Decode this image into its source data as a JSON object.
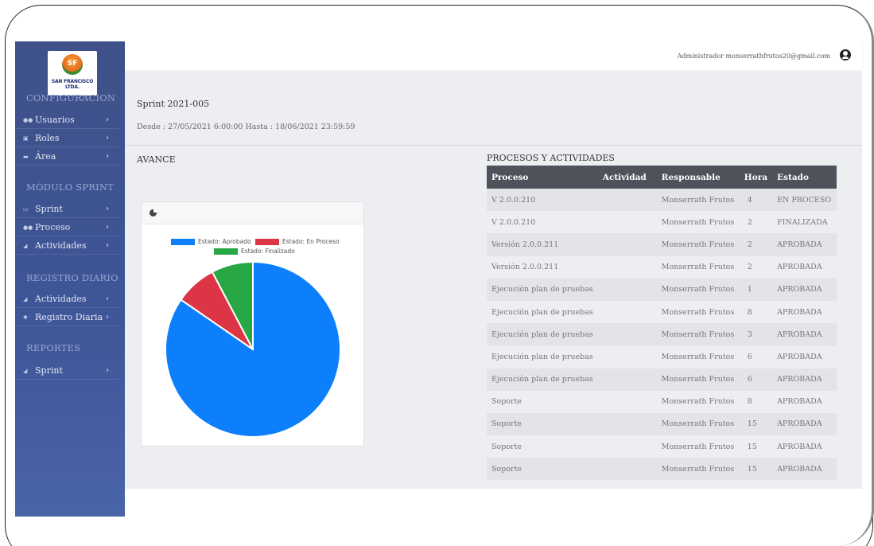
{
  "header": {
    "user_role": "Administrador",
    "user_email": "monserrathfrutos20@gmail.com"
  },
  "logo": {
    "initials": "SF",
    "company": "SAN FRANCISCO LTDA."
  },
  "sidebar": {
    "sections": [
      {
        "title": "CONFIGURACION"
      },
      {
        "title": "MÓDULO SPRINT"
      },
      {
        "title": "REGISTRO DIARIO"
      },
      {
        "title": "REPORTES"
      }
    ],
    "items": [
      {
        "label": "Usuarios",
        "icon": "users-icon"
      },
      {
        "label": "Roles",
        "icon": "roles-icon"
      },
      {
        "label": "Área",
        "icon": "folder-icon"
      },
      {
        "label": "Sprint",
        "icon": "sprint-icon"
      },
      {
        "label": "Proceso",
        "icon": "process-icon"
      },
      {
        "label": "Actividades",
        "icon": "activities-icon"
      },
      {
        "label": "Actividades",
        "icon": "activities-icon"
      },
      {
        "label": "Registro Diaria",
        "icon": "daily-log-icon"
      },
      {
        "label": "Sprint",
        "icon": "report-icon"
      }
    ]
  },
  "main": {
    "sprint_title": "Sprint 2021-005",
    "sprint_range": "Desde : 27/05/2021 6:00:00 Hasta : 18/06/2021 23:59:59",
    "avance_title": "AVANCE",
    "procesos_title": "PROCESOS Y ACTIVIDADES"
  },
  "chart_data": {
    "type": "pie",
    "categories": [
      "Estado: Aprobado",
      "Estado: En Proceso",
      "Estado: Finalizado"
    ],
    "values": [
      11,
      1,
      1
    ],
    "colors": [
      "#0d7ffb",
      "#dc3545",
      "#28a745"
    ],
    "legend": "top"
  },
  "table": {
    "headers": [
      "Proceso",
      "Actividad",
      "Responsable",
      "Hora",
      "Estado"
    ],
    "rows": [
      [
        "V 2.0.0.210",
        "",
        "Monserrath Frutos",
        "4",
        "EN PROCESO"
      ],
      [
        "V 2.0.0.210",
        "",
        "Monserrath Frutos",
        "2",
        "FINALIZADA"
      ],
      [
        "Versión 2.0.0.211",
        "",
        "Monserrath Frutos",
        "2",
        "APROBADA"
      ],
      [
        "Versión 2.0.0.211",
        "",
        "Monserrath Frutos",
        "2",
        "APROBADA"
      ],
      [
        "Ejecución plan de pruebas",
        "",
        "Monserrath Frutos",
        "1",
        "APROBADA"
      ],
      [
        "Ejecución plan de pruebas",
        "",
        "Monserrath Frutos",
        "8",
        "APROBADA"
      ],
      [
        "Ejecución plan de pruebas",
        "",
        "Monserrath Frutos",
        "3",
        "APROBADA"
      ],
      [
        "Ejecución plan de pruebas",
        "",
        "Monserrath Frutos",
        "6",
        "APROBADA"
      ],
      [
        "Ejecución plan de pruebas",
        "",
        "Monserrath Frutos",
        "6",
        "APROBADA"
      ],
      [
        "Soporte",
        "",
        "Monserrath Frutos",
        "8",
        "APROBADA"
      ],
      [
        "Soporte",
        "",
        "Monserrath Frutos",
        "15",
        "APROBADA"
      ],
      [
        "Soporte",
        "",
        "Monserrath Frutos",
        "15",
        "APROBADA"
      ],
      [
        "Soporte",
        "",
        "Monserrath Frutos",
        "15",
        "APROBADA"
      ]
    ]
  }
}
